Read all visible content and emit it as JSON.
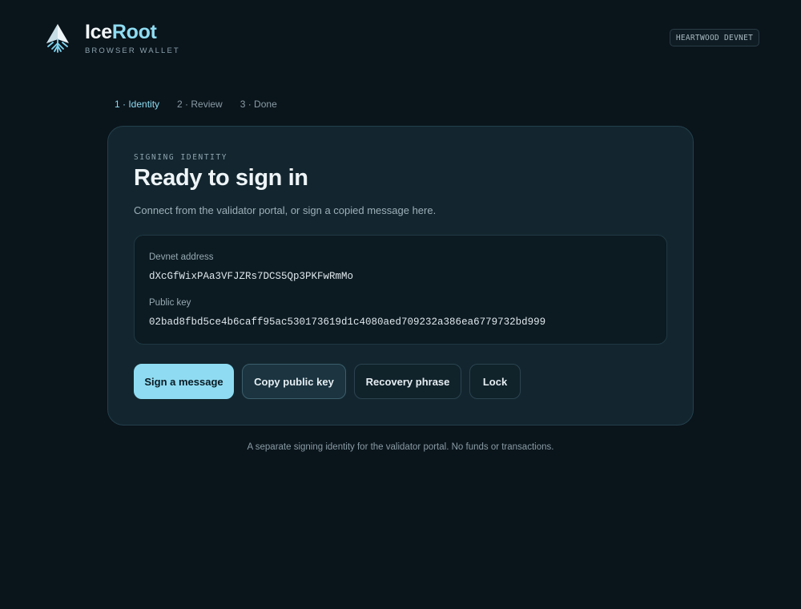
{
  "brand": {
    "name_part1": "Ice",
    "name_part2": "Root",
    "subtitle": "BROWSER WALLET",
    "logo_icon": "snowflake-tree-logo",
    "accent_color": "#8fdcf2"
  },
  "network_badge": "HEARTWOOD DEVNET",
  "steps": [
    {
      "label": "1 · Identity",
      "active": true
    },
    {
      "label": "2 · Review",
      "active": false
    },
    {
      "label": "3 · Done",
      "active": false
    }
  ],
  "card": {
    "eyebrow": "SIGNING IDENTITY",
    "title": "Ready to sign in",
    "description": "Connect from the validator portal, or sign a copied message here.",
    "address_label": "Devnet address",
    "address_value": "dXcGfWixPAa3VFJZRs7DCS5Qp3PKFwRmMo",
    "pubkey_label": "Public key",
    "pubkey_value": "02bad8fbd5ce4b6caff95ac530173619d1c4080aed709232a386ea6779732bd999"
  },
  "actions": {
    "sign": "Sign a message",
    "copy": "Copy public key",
    "recovery": "Recovery phrase",
    "lock": "Lock"
  },
  "footer_note": "A separate signing identity for the validator portal. No funds or transactions."
}
